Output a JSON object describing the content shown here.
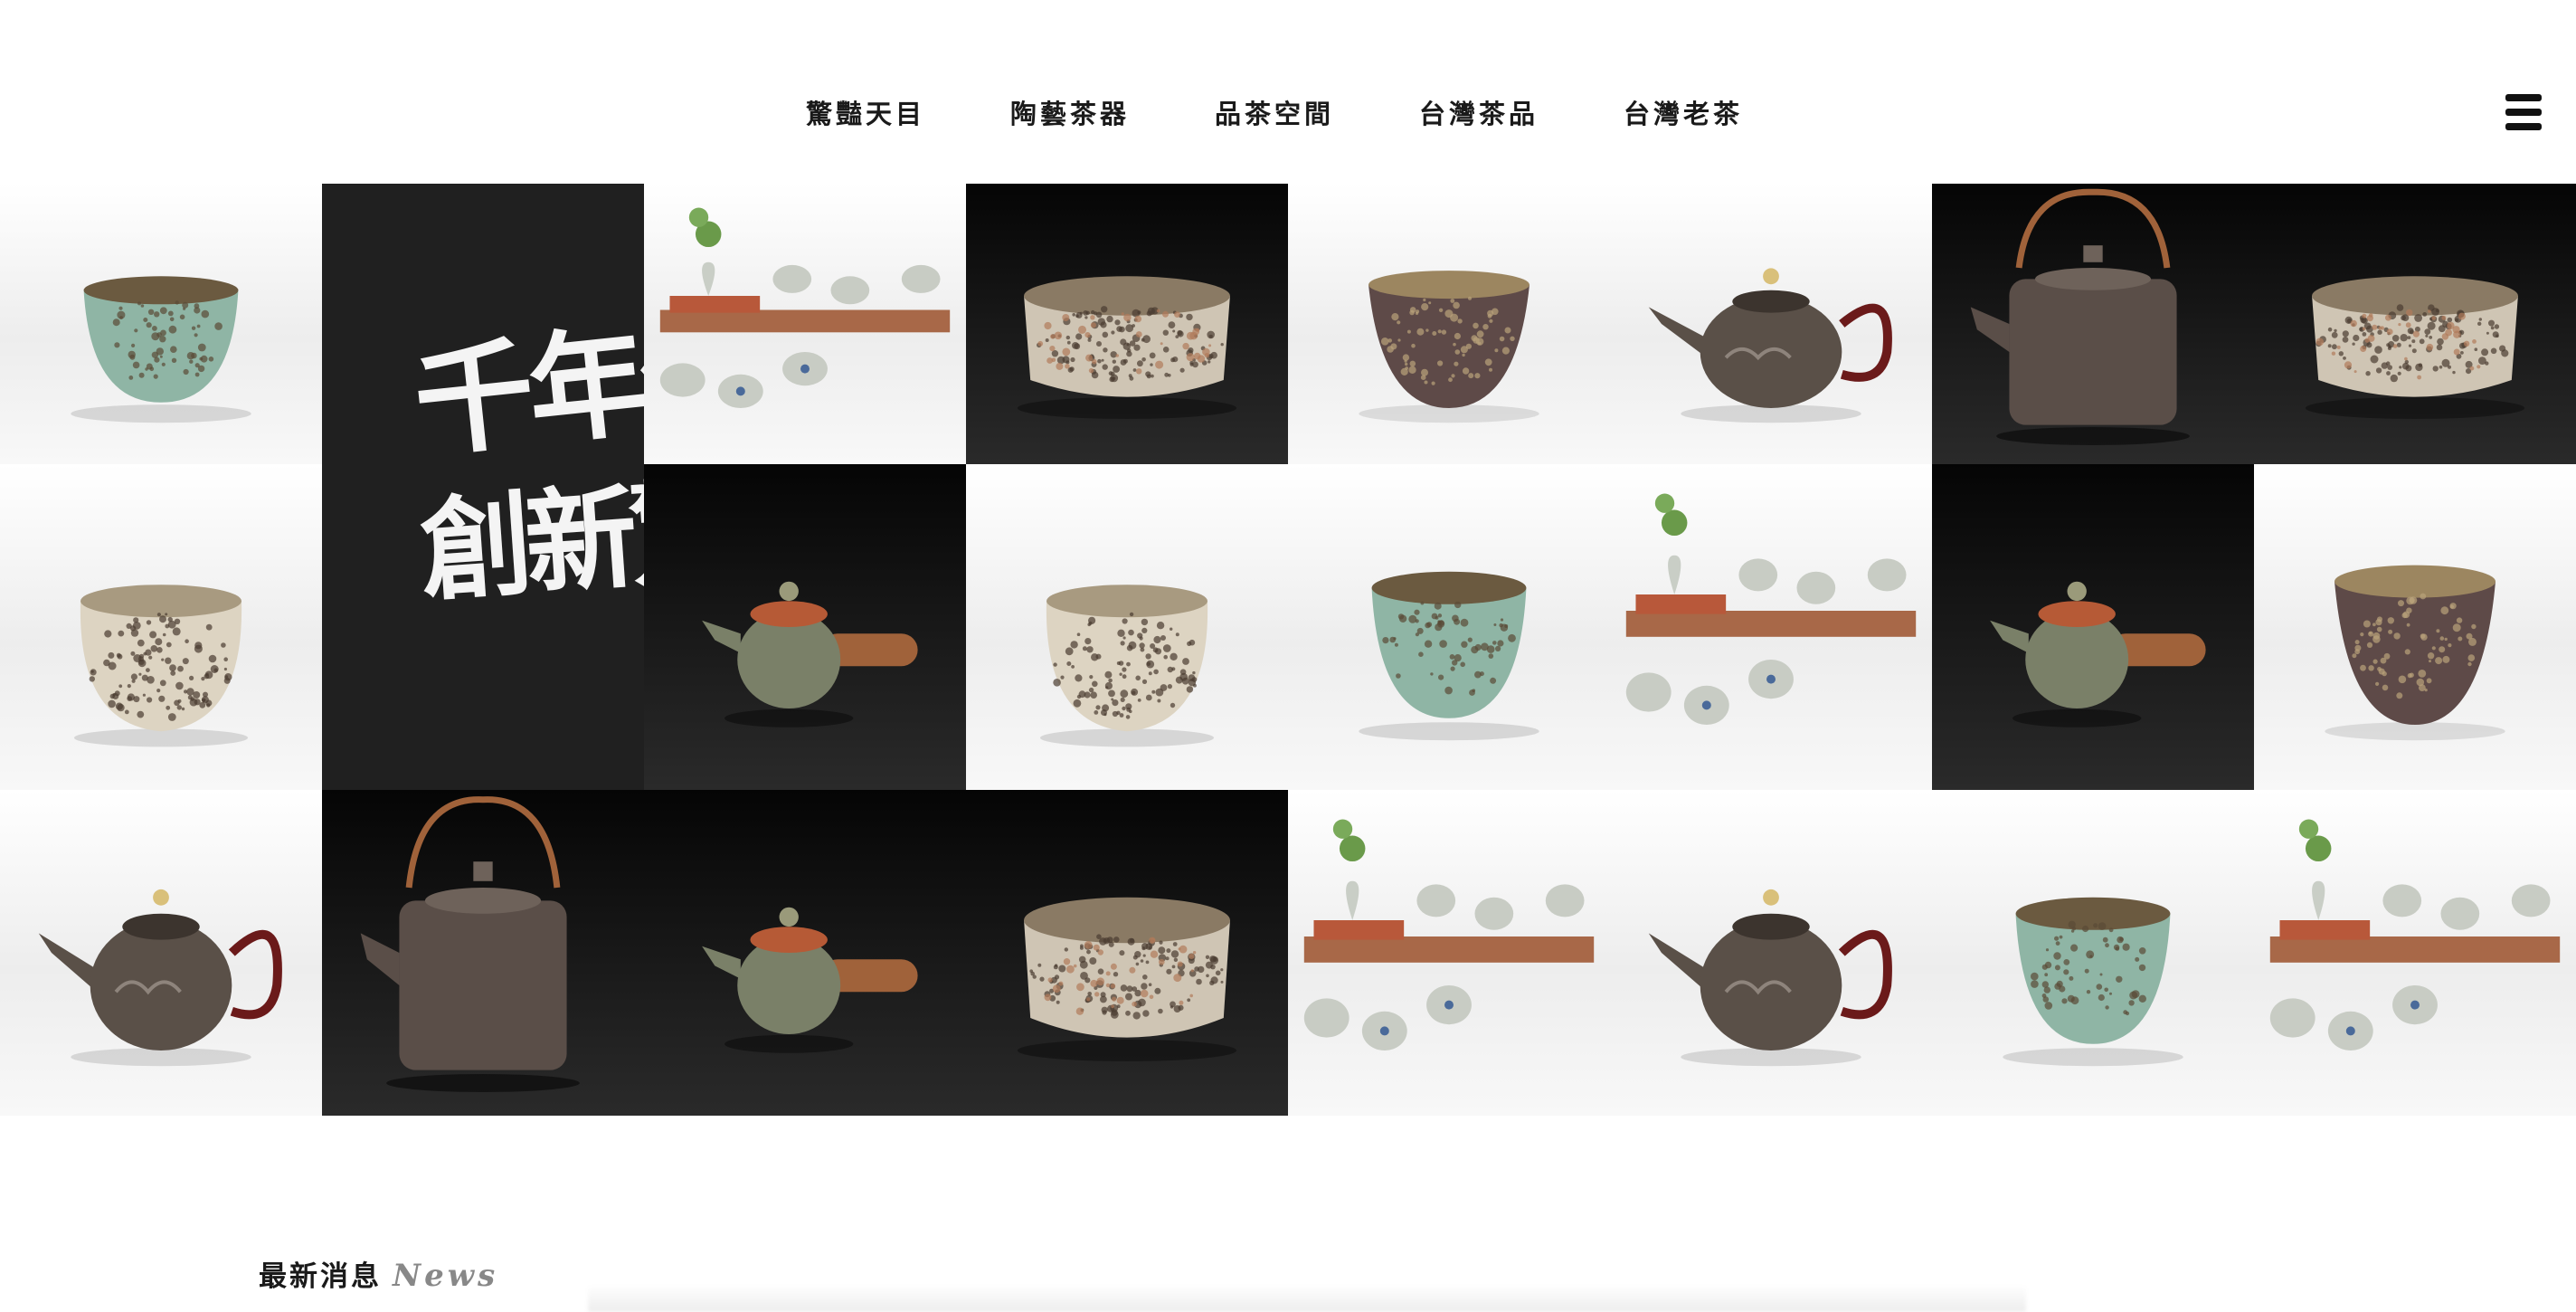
{
  "nav": {
    "items": [
      {
        "label": "驚豔天目"
      },
      {
        "label": "陶藝茶器"
      },
      {
        "label": "品茶空間"
      },
      {
        "label": "台灣茶品"
      },
      {
        "label": "台灣老茶"
      }
    ],
    "menu_icon": "hamburger-menu-icon"
  },
  "hero": {
    "calligraphy_line1": "千年傳承",
    "calligraphy_line2": "創新驚艷",
    "background": "#202020"
  },
  "gallery": {
    "tiles": [
      {
        "product": "celadon-tea-bowl",
        "bg": "light"
      },
      {
        "product": "tea-cup-set-with-tray",
        "bg": "light"
      },
      {
        "product": "speckled-tea-bowl",
        "bg": "dark"
      },
      {
        "product": "brown-tea-bowl",
        "bg": "light"
      },
      {
        "product": "cloud-teapot",
        "bg": "light"
      },
      {
        "product": "iron-kettle",
        "bg": "dark"
      },
      {
        "product": "speckled-tea-bowl",
        "bg": "dark"
      },
      {
        "product": "speckled-tea-jar",
        "bg": "light"
      },
      {
        "product": "side-handle-teapot",
        "bg": "dark"
      },
      {
        "product": "speckled-tea-jar",
        "bg": "light"
      },
      {
        "product": "celadon-tea-bowl",
        "bg": "light"
      },
      {
        "product": "tea-cup-set-with-tray",
        "bg": "light"
      },
      {
        "product": "side-handle-teapot",
        "bg": "dark"
      },
      {
        "product": "brown-tea-bowl",
        "bg": "light"
      },
      {
        "product": "cloud-teapot",
        "bg": "light"
      },
      {
        "product": "iron-kettle",
        "bg": "dark"
      },
      {
        "product": "side-handle-teapot",
        "bg": "dark"
      },
      {
        "product": "speckled-tea-bowl",
        "bg": "dark"
      },
      {
        "product": "tea-cup-set-with-tray",
        "bg": "light"
      },
      {
        "product": "cloud-teapot",
        "bg": "light"
      }
    ]
  },
  "news": {
    "title_zh": "最新消息",
    "title_en": "News"
  },
  "colors": {
    "light_bg": "#eeeeee",
    "dark_bg": "#141414",
    "celadon": "#8fb5a5",
    "clay_brown": "#6b5a50",
    "copper": "#a0623a",
    "wood": "#a86848"
  }
}
